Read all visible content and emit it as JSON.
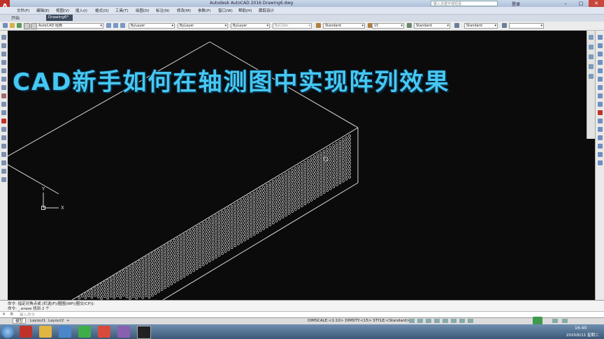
{
  "app": {
    "logo_letter": "A",
    "title": "Autodesk AutoCAD 2016    Drawing6.dwg",
    "search_placeholder": "键入关键字或短语",
    "user": "登录"
  },
  "menu": [
    "文件(F)",
    "编辑(E)",
    "视图(V)",
    "插入(I)",
    "格式(O)",
    "工具(T)",
    "绘图(D)",
    "标注(N)",
    "修改(M)",
    "参数(P)",
    "窗口(W)",
    "帮助(H)",
    "跟踪设计"
  ],
  "ribbon": {
    "start_tab": "开始"
  },
  "document": {
    "tab_label": "Drawing6*"
  },
  "toolbar": {
    "workspace": "AutoCAD 经典",
    "layer": "ByLayer",
    "linetype": "ByLayer",
    "lineweight": "ByLayer",
    "plotstyle": "ByColor",
    "textstyle": "Standard",
    "textheight": "15",
    "dimstyle": "Standard",
    "tablestyle": "Standard"
  },
  "overlay": {
    "title": "CAD新手如何在轴测图中实现阵列效果"
  },
  "ucs": {
    "x_label": "X",
    "y_label": "Y"
  },
  "command": {
    "line1": "命令: 指定对角点或 [栏选(F)/圈围(WP)/圈交(CP)]:",
    "line2": "命令: _.erase 找到 2 个",
    "input_placeholder": "键入命令"
  },
  "layout_tabs": [
    "模型",
    "Layout1",
    "Layout2",
    "+"
  ],
  "status": {
    "text": "DIMSCALE:<1:10> DIMSTY:<15> STYLE:<Standard>"
  },
  "clock": {
    "time": "16:40",
    "date": "2020/6/11 星期二"
  },
  "colors": {
    "accent_title": "#46c8f3",
    "canvas": "#0b0b0b",
    "taskbar": "#3c5878"
  }
}
